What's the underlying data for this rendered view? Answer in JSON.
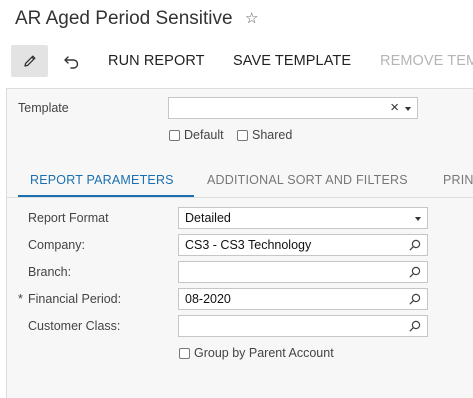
{
  "page": {
    "title": "AR Aged Period Sensitive"
  },
  "toolbar": {
    "run_report": "RUN REPORT",
    "save_template": "SAVE TEMPLATE",
    "remove_template": "REMOVE TEM"
  },
  "template": {
    "label": "Template",
    "value": "",
    "default_label": "Default",
    "shared_label": "Shared",
    "default_checked": false,
    "shared_checked": false
  },
  "tabs": [
    {
      "label": "REPORT PARAMETERS",
      "active": true
    },
    {
      "label": "ADDITIONAL SORT AND FILTERS",
      "active": false
    },
    {
      "label": "PRIN",
      "active": false
    }
  ],
  "params": {
    "report_format": {
      "label": "Report Format",
      "value": "Detailed"
    },
    "company": {
      "label": "Company:",
      "value": "CS3 - CS3 Technology"
    },
    "branch": {
      "label": "Branch:",
      "value": ""
    },
    "financial_period": {
      "label": "Financial Period:",
      "value": "08-2020",
      "required_marker": "*"
    },
    "customer_class": {
      "label": "Customer Class:",
      "value": ""
    },
    "group_by_parent": {
      "label": "Group by Parent Account",
      "checked": false
    }
  },
  "colors": {
    "accent": "#1a6fb0",
    "panel_bg": "#f7f7f7"
  }
}
